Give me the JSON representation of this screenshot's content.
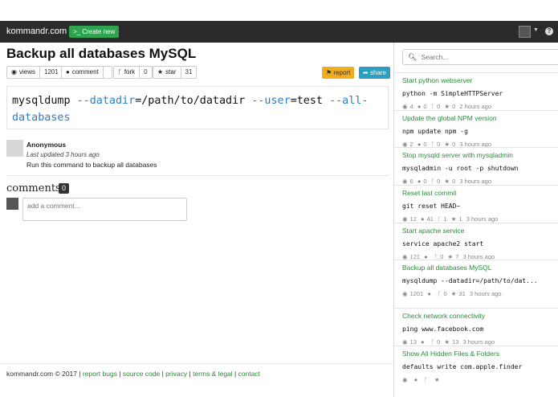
{
  "nav": {
    "brand": "kommandr.com",
    "create_label": ">_ Create new"
  },
  "command": {
    "title": "Backup all databases MySQL",
    "stats": {
      "views_label": "views",
      "views": "1201",
      "comment_label": "comment",
      "comment": "",
      "fork_label": "fork",
      "fork": "0",
      "star_label": "star",
      "star": "31"
    },
    "report_label": "report",
    "share_label": "share",
    "code_parts": {
      "p1": "mysqldump ",
      "p2": "--datadir",
      "p3": "=/path/to/datadir ",
      "p4": "--user",
      "p5": "=test ",
      "p6": "--all-",
      "p7": "databases"
    },
    "author": "Anonymous",
    "updated": "Last updated 3 hours ago",
    "description": "Run this command to backup all databases"
  },
  "comments": {
    "title": "comments",
    "count": "0",
    "placeholder": "add a comment..."
  },
  "footer": {
    "copyright": "kommandr.com © 2017",
    "links": [
      "report bugs",
      "source code",
      "privacy",
      "terms & legal",
      "contact"
    ]
  },
  "sidebar": {
    "search_placeholder": "Search...",
    "items": [
      {
        "title": "Start python webserver",
        "cmd": "python -m SimpleHTTPServer",
        "views": "4",
        "comments": "0",
        "forks": "0",
        "stars": "0",
        "time": "2 hours ago"
      },
      {
        "title": "Update the global NPM version",
        "cmd": "npm update npm -g",
        "views": "2",
        "comments": "0",
        "forks": "0",
        "stars": "0",
        "time": "3 hours ago"
      },
      {
        "title": "Stop mysqld server with mysqladmin",
        "cmd": "mysqladmin -u root -p shutdown",
        "views": "6",
        "comments": "0",
        "forks": "0",
        "stars": "0",
        "time": "3 hours ago"
      },
      {
        "title": "Reset last commit",
        "cmd": "git reset HEAD~",
        "views": "12",
        "comments": "41",
        "forks": "1",
        "stars": "1",
        "time": "3 hours ago"
      },
      {
        "title": "Start apache service",
        "cmd": "service apache2 start",
        "views": "121",
        "comments": "",
        "forks": "0",
        "stars": "7",
        "time": "3 hours ago"
      },
      {
        "title": "Backup all databases MySQL",
        "cmd": "mysqldump --datadir=/path/to/dat...",
        "views": "1201",
        "comments": "",
        "forks": "0",
        "stars": "31",
        "time": "3 hours ago"
      },
      {
        "title": "Check network connectivity",
        "cmd": "ping www.facebook.com",
        "views": "13",
        "comments": "",
        "forks": "0",
        "stars": "13",
        "time": "3 hours ago"
      },
      {
        "title": "Show All Hidden Files & Folders",
        "cmd": "defaults write com.apple.finder",
        "views": "",
        "comments": "",
        "forks": "",
        "stars": "",
        "time": ""
      }
    ]
  }
}
